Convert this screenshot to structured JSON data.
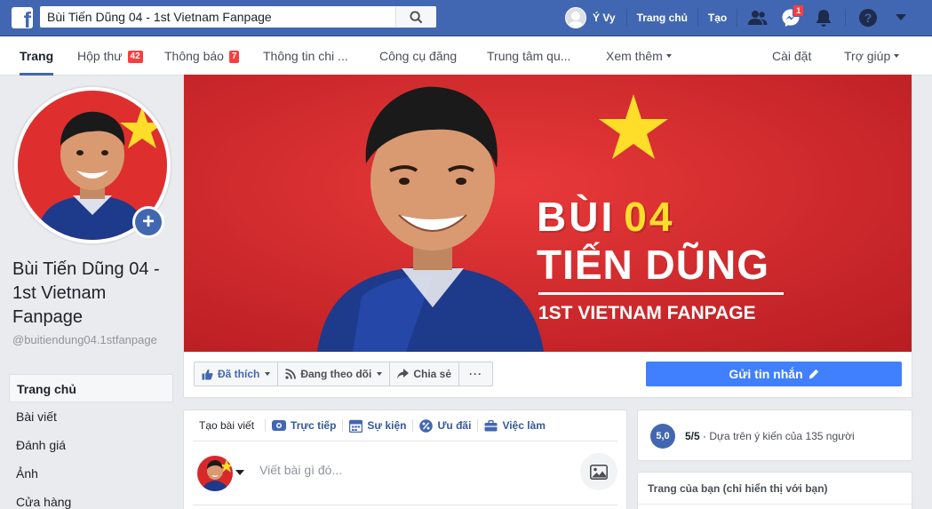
{
  "topbar": {
    "logo": "f",
    "search_value": "Bùi Tiến Dũng 04 - 1st Vietnam Fanpage",
    "user_name": "Ý Vy",
    "home_label": "Trang chủ",
    "create_label": "Tạo",
    "messenger_badge": "1",
    "icons": [
      "search-icon",
      "friends-icon",
      "messenger-icon",
      "bell-icon",
      "help-icon",
      "dropdown-icon"
    ],
    "brand_color": "#4267b2"
  },
  "pagenav": {
    "tabs": [
      {
        "label": "Trang",
        "active": true
      },
      {
        "label": "Hộp thư",
        "badge": "42"
      },
      {
        "label": "Thông báo",
        "badge": "7"
      },
      {
        "label": "Thông tin chi ..."
      },
      {
        "label": "Công cụ đăng"
      },
      {
        "label": "Trung tâm qu..."
      },
      {
        "label": "Xem thêm"
      },
      {
        "label": "Cài đặt"
      },
      {
        "label": "Trợ giúp"
      }
    ]
  },
  "page": {
    "name": "Bùi Tiến Dũng 04 - 1st Vietnam Fanpage",
    "handle": "@buitiendung04.1stfanpage",
    "add_icon": "+"
  },
  "left_menu": [
    "Trang chủ",
    "Bài viết",
    "Đánh giá",
    "Ảnh",
    "Cửa hàng"
  ],
  "cover": {
    "line1": "BÙI",
    "line1_number": "04",
    "line2": "TIẾN DŨNG",
    "subtitle": "1ST VIETNAM FANPAGE",
    "accent_red": "#d9282a",
    "accent_yellow": "#ffde2a"
  },
  "actions": {
    "liked": "Đã thích",
    "following": "Đang theo dõi",
    "share": "Chia sẻ",
    "more": "···",
    "send_message": "Gửi tin nhắn"
  },
  "composer": {
    "tabs": [
      "Tạo bài viết",
      "Trực tiếp",
      "Sự kiện",
      "Ưu đãi",
      "Việc làm"
    ],
    "placeholder": "Viết bài gì đó..."
  },
  "rating": {
    "score": "5,0",
    "value": "5/5",
    "text": "Dựa trên ý kiến của 135 người"
  },
  "your_page": {
    "title": "Trang của bạn (chỉ hiển thị với bạn)"
  }
}
